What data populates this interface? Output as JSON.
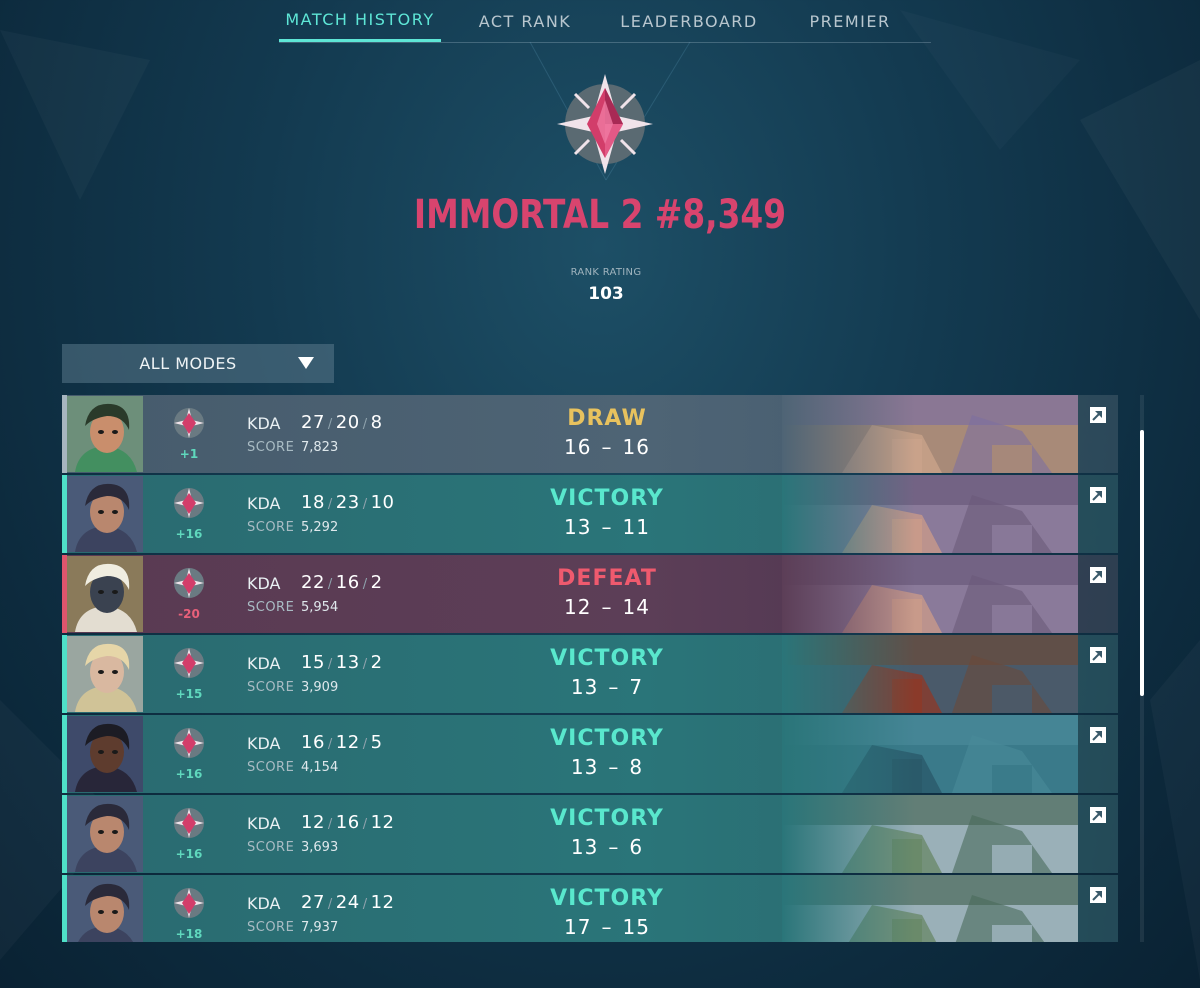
{
  "nav": {
    "tabs": [
      {
        "label": "MATCH HISTORY",
        "active": true
      },
      {
        "label": "ACT RANK",
        "active": false
      },
      {
        "label": "LEADERBOARD",
        "active": false
      },
      {
        "label": "PREMIER",
        "active": false
      }
    ]
  },
  "rank": {
    "title": "IMMORTAL 2 #8,349",
    "rating_label": "RANK RATING",
    "rating_value": "103",
    "icon": "immortal-rank-icon",
    "color": "#d8446e"
  },
  "filter": {
    "selected": "ALL MODES",
    "icon": "caret-down-icon"
  },
  "colors": {
    "victory": "#59e8cd",
    "defeat": "#ef5a6e",
    "draw": "#e8c25e",
    "accent": "#5ee6d6"
  },
  "matches": [
    {
      "result": "DRAW",
      "type": "draw",
      "rr_change": "+1",
      "kda_label": "KDA",
      "kills": "27",
      "deaths": "20",
      "assists": "8",
      "score_label": "SCORE",
      "score": "7,823",
      "rounds_won": "16",
      "rounds_lost": "16",
      "agent_icon": "agent-portrait-killjoy",
      "map_icon": "map-thumbnail-ascent"
    },
    {
      "result": "VICTORY",
      "type": "victory",
      "rr_change": "+16",
      "kda_label": "KDA",
      "kills": "18",
      "deaths": "23",
      "assists": "10",
      "score_label": "SCORE",
      "score": "5,292",
      "rounds_won": "13",
      "rounds_lost": "11",
      "agent_icon": "agent-portrait-reyna",
      "map_icon": "map-thumbnail-sunset"
    },
    {
      "result": "DEFEAT",
      "type": "defeat",
      "rr_change": "-20",
      "kda_label": "KDA",
      "kills": "22",
      "deaths": "16",
      "assists": "2",
      "score_label": "SCORE",
      "score": "5,954",
      "rounds_won": "12",
      "rounds_lost": "14",
      "agent_icon": "agent-portrait-cypher",
      "map_icon": "map-thumbnail-sunset"
    },
    {
      "result": "VICTORY",
      "type": "victory",
      "rr_change": "+15",
      "kda_label": "KDA",
      "kills": "15",
      "deaths": "13",
      "assists": "2",
      "score_label": "SCORE",
      "score": "3,909",
      "rounds_won": "13",
      "rounds_lost": "7",
      "agent_icon": "agent-portrait-chamber",
      "map_icon": "map-thumbnail-split"
    },
    {
      "result": "VICTORY",
      "type": "victory",
      "rr_change": "+16",
      "kda_label": "KDA",
      "kills": "16",
      "deaths": "12",
      "assists": "5",
      "score_label": "SCORE",
      "score": "4,154",
      "rounds_won": "13",
      "rounds_lost": "8",
      "agent_icon": "agent-portrait-iso",
      "map_icon": "map-thumbnail-pearl"
    },
    {
      "result": "VICTORY",
      "type": "victory",
      "rr_change": "+16",
      "kda_label": "KDA",
      "kills": "12",
      "deaths": "16",
      "assists": "12",
      "score_label": "SCORE",
      "score": "3,693",
      "rounds_won": "13",
      "rounds_lost": "6",
      "agent_icon": "agent-portrait-reyna",
      "map_icon": "map-thumbnail-lotus"
    },
    {
      "result": "VICTORY",
      "type": "victory",
      "rr_change": "+18",
      "kda_label": "KDA",
      "kills": "27",
      "deaths": "24",
      "assists": "12",
      "score_label": "SCORE",
      "score": "7,937",
      "rounds_won": "17",
      "rounds_lost": "15",
      "agent_icon": "agent-portrait-reyna",
      "map_icon": "map-thumbnail-lotus"
    }
  ]
}
